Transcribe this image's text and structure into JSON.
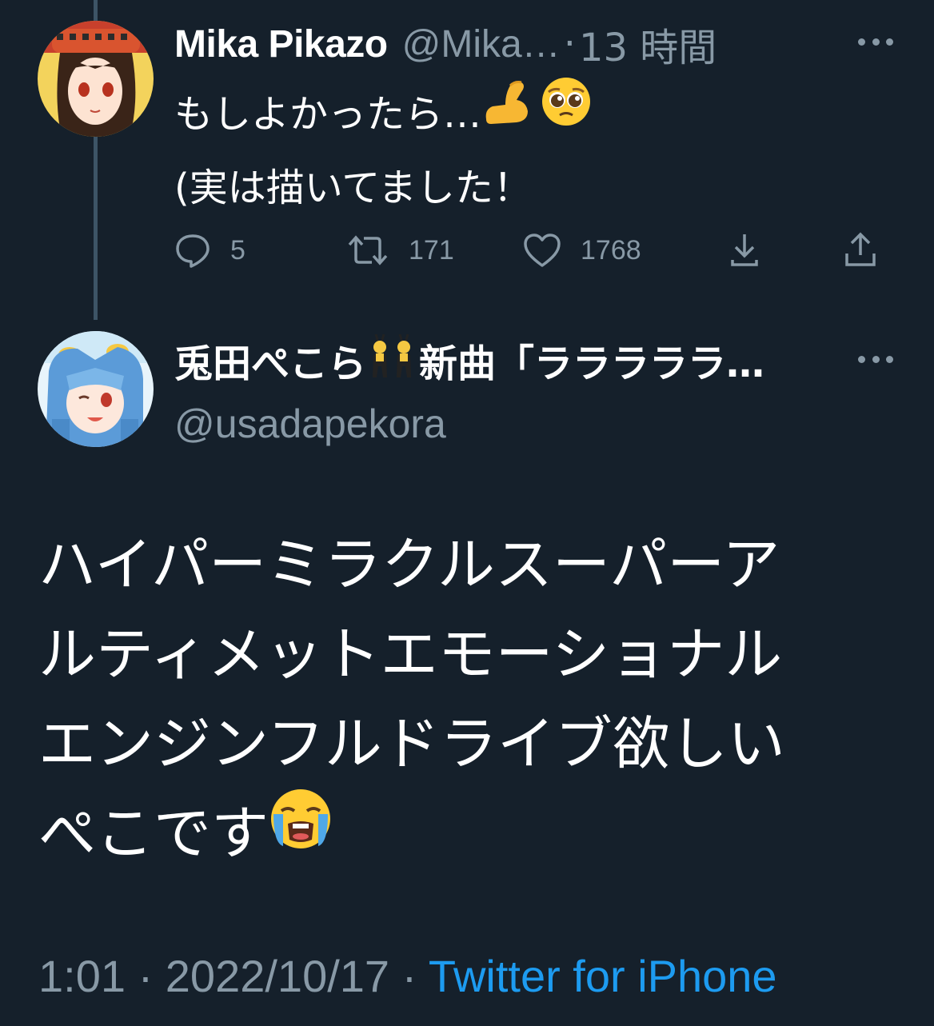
{
  "reply_tweet": {
    "display_name": "Mika Pikazo",
    "handle": "@Mika…",
    "separator": "·",
    "time": "13 時間",
    "text_line1": "もしよかったら…",
    "text_line2": "(実は描いてました！",
    "emojis": [
      "flexed-biceps",
      "pleading-face"
    ],
    "actions": {
      "reply_count": "5",
      "retweet_count": "171",
      "like_count": "1768"
    }
  },
  "main_tweet": {
    "display_name_part1": "兎田ぺこら",
    "display_name_part2": "新曲「ラララララ…",
    "name_emoji": "women-with-bunny-ears",
    "handle": "@usadapekora",
    "text_lines": [
      "ハイパーミラクルスーパーア",
      "ルティメットエモーショナル",
      "エンジンフルドライブ欲しい",
      "ぺこです"
    ],
    "text_emoji": "loudly-crying-face",
    "time": "1:01",
    "separator": "·",
    "date": "2022/10/17",
    "separator2": "·",
    "source": "Twitter for iPhone"
  },
  "colors": {
    "background": "#15202b",
    "text": "#ffffff",
    "secondary": "#8899a6",
    "link": "#1d9bf0"
  }
}
